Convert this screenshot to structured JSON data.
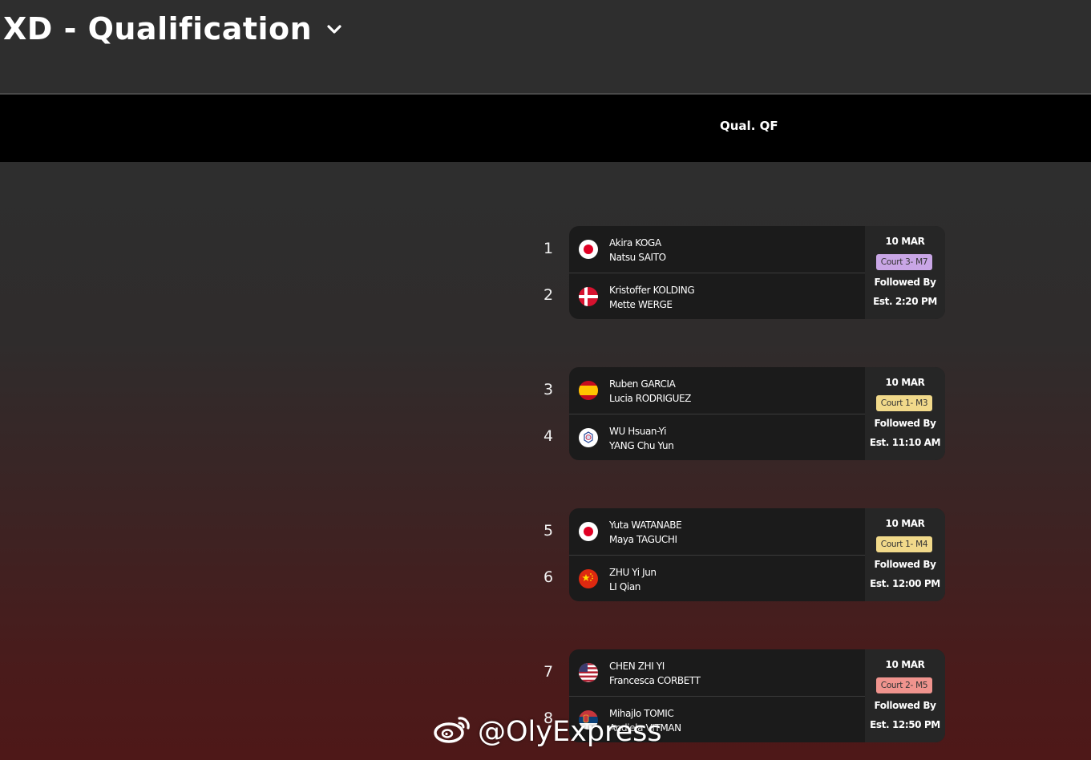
{
  "header": {
    "title": "XD - Qualification"
  },
  "round": {
    "label": "Qual. QF"
  },
  "matches": [
    {
      "seeds": [
        "1",
        "2"
      ],
      "teams": [
        {
          "flag": "japan-flag",
          "player1": "Akira KOGA",
          "player2": "Natsu SAITO"
        },
        {
          "flag": "denmark-flag",
          "player1": "Kristoffer KOLDING",
          "player2": "Mette WERGE"
        }
      ],
      "date": "10 MAR",
      "court": "Court 3- M7",
      "court_color": "#c9a6e6",
      "followed": "Followed By",
      "est": "Est. 2:20 PM"
    },
    {
      "seeds": [
        "3",
        "4"
      ],
      "teams": [
        {
          "flag": "spain-flag",
          "player1": "Ruben GARCIA",
          "player2": "Lucia RODRIGUEZ"
        },
        {
          "flag": "chinese-taipei-flag",
          "player1": "WU Hsuan-Yi",
          "player2": "YANG Chu Yun"
        }
      ],
      "date": "10 MAR",
      "court": "Court 1- M3",
      "court_color": "#f1d98a",
      "followed": "Followed By",
      "est": "Est. 11:10 AM"
    },
    {
      "seeds": [
        "5",
        "6"
      ],
      "teams": [
        {
          "flag": "japan-flag",
          "player1": "Yuta WATANABE",
          "player2": "Maya TAGUCHI"
        },
        {
          "flag": "china-flag",
          "player1": "ZHU Yi Jun",
          "player2": "LI Qian"
        }
      ],
      "date": "10 MAR",
      "court": "Court 1- M4",
      "court_color": "#f1d98a",
      "followed": "Followed By",
      "est": "Est. 12:00 PM"
    },
    {
      "seeds": [
        "7",
        "8"
      ],
      "teams": [
        {
          "flag": "usa-flag",
          "player1": "CHEN ZHI YI",
          "player2": "Francesca CORBETT"
        },
        {
          "flag": "serbia-flag",
          "player1": "Mihajlo TOMIC",
          "player2": "Andjela VITMAN"
        }
      ],
      "date": "10 MAR",
      "court": "Court 2- M5",
      "court_color": "#f0948e",
      "followed": "Followed By",
      "est": "Est. 12:50 PM"
    }
  ],
  "watermark": {
    "text": "@OlyExpress",
    "icon": "weibo-icon"
  }
}
